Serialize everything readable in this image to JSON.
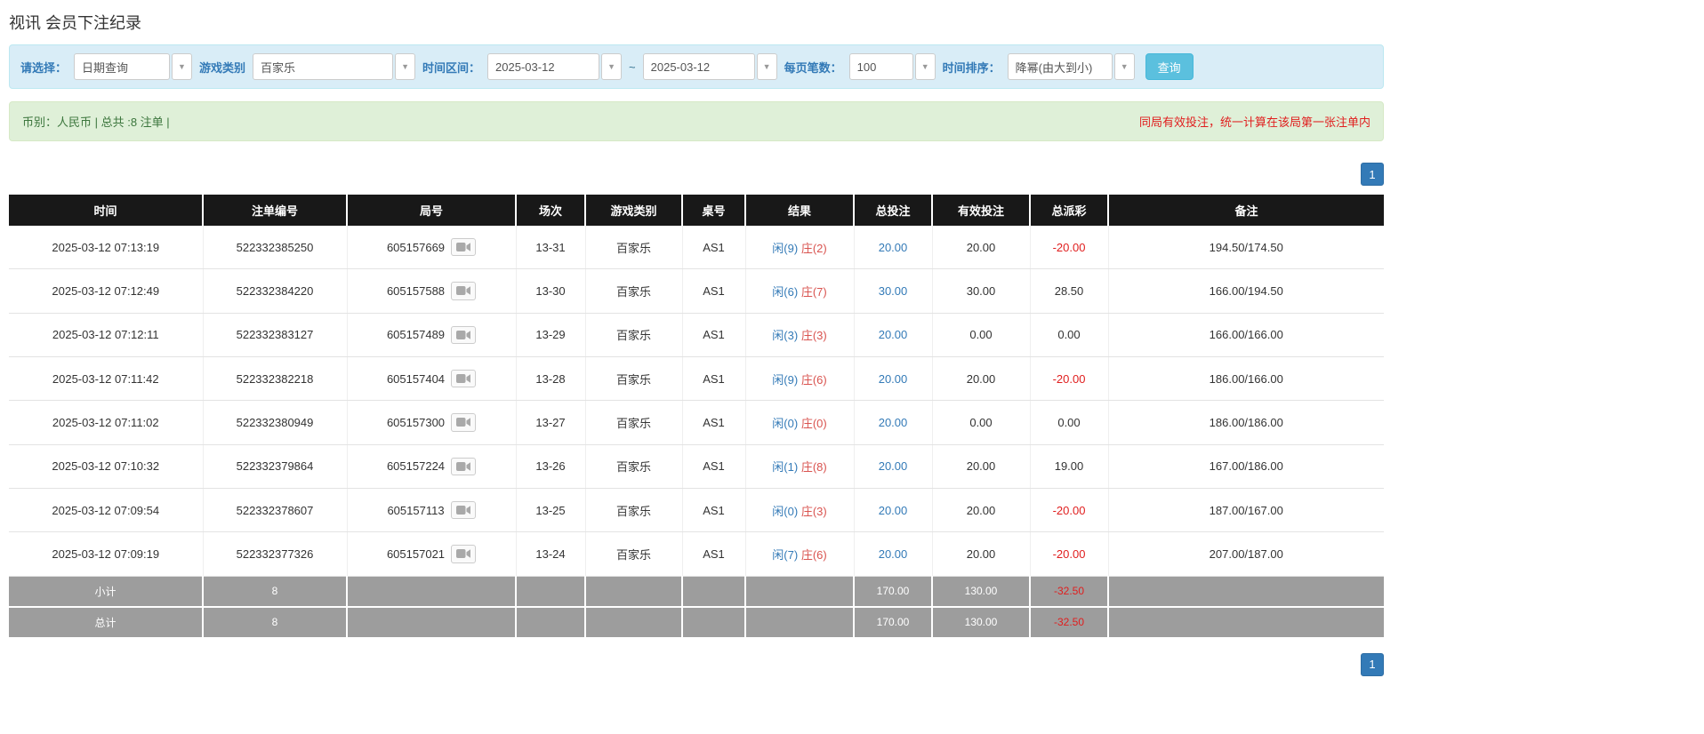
{
  "page": {
    "title": "视讯 会员下注纪录"
  },
  "colors": {
    "accent_blue": "#337ab7",
    "result_banker_red": "#d9534f",
    "negative_red": "#e01e1e",
    "filter_bg": "#d9edf7",
    "summary_bg": "#dff0d8",
    "header_bg": "#181818",
    "footer_bg": "#9d9d9d",
    "search_button_bg": "#5bc0de"
  },
  "icons": {
    "caret": "▼",
    "video": "video-camera-icon"
  },
  "filters": {
    "select_label": "请选择：",
    "select_value": "日期查询",
    "game_type_label": "游戏类别",
    "game_type_value": "百家乐",
    "time_range_label": "时间区间：",
    "date_from": "2025-03-12",
    "range_separator": "~",
    "date_to": "2025-03-12",
    "per_page_label": "每页笔数：",
    "per_page_value": "100",
    "sort_label": "时间排序：",
    "sort_value": "降幂(由大到小)",
    "search_button": "查询"
  },
  "summary": {
    "left": "币别：人民币 | 总共 :8 注单 |",
    "right": "同局有效投注，统一计算在该局第一张注单内"
  },
  "pagination": {
    "page": "1"
  },
  "table": {
    "headers": [
      "时间",
      "注单编号",
      "局号",
      "场次",
      "游戏类别",
      "桌号",
      "结果",
      "总投注",
      "有效投注",
      "总派彩",
      "备注"
    ],
    "rows": [
      {
        "time": "2025-03-12 07:13:19",
        "bet_id": "522332385250",
        "round": "605157669",
        "session": "13-31",
        "game": "百家乐",
        "table_no": "AS1",
        "player": "闲(9)",
        "banker": "庄(2)",
        "total_bet": "20.00",
        "valid_bet": "20.00",
        "payout": "-20.00",
        "remark": "194.50/174.50"
      },
      {
        "time": "2025-03-12 07:12:49",
        "bet_id": "522332384220",
        "round": "605157588",
        "session": "13-30",
        "game": "百家乐",
        "table_no": "AS1",
        "player": "闲(6)",
        "banker": "庄(7)",
        "total_bet": "30.00",
        "valid_bet": "30.00",
        "payout": "28.50",
        "remark": "166.00/194.50"
      },
      {
        "time": "2025-03-12 07:12:11",
        "bet_id": "522332383127",
        "round": "605157489",
        "session": "13-29",
        "game": "百家乐",
        "table_no": "AS1",
        "player": "闲(3)",
        "banker": "庄(3)",
        "total_bet": "20.00",
        "valid_bet": "0.00",
        "payout": "0.00",
        "remark": "166.00/166.00"
      },
      {
        "time": "2025-03-12 07:11:42",
        "bet_id": "522332382218",
        "round": "605157404",
        "session": "13-28",
        "game": "百家乐",
        "table_no": "AS1",
        "player": "闲(9)",
        "banker": "庄(6)",
        "total_bet": "20.00",
        "valid_bet": "20.00",
        "payout": "-20.00",
        "remark": "186.00/166.00"
      },
      {
        "time": "2025-03-12 07:11:02",
        "bet_id": "522332380949",
        "round": "605157300",
        "session": "13-27",
        "game": "百家乐",
        "table_no": "AS1",
        "player": "闲(0)",
        "banker": "庄(0)",
        "total_bet": "20.00",
        "valid_bet": "0.00",
        "payout": "0.00",
        "remark": "186.00/186.00"
      },
      {
        "time": "2025-03-12 07:10:32",
        "bet_id": "522332379864",
        "round": "605157224",
        "session": "13-26",
        "game": "百家乐",
        "table_no": "AS1",
        "player": "闲(1)",
        "banker": "庄(8)",
        "total_bet": "20.00",
        "valid_bet": "20.00",
        "payout": "19.00",
        "remark": "167.00/186.00"
      },
      {
        "time": "2025-03-12 07:09:54",
        "bet_id": "522332378607",
        "round": "605157113",
        "session": "13-25",
        "game": "百家乐",
        "table_no": "AS1",
        "player": "闲(0)",
        "banker": "庄(3)",
        "total_bet": "20.00",
        "valid_bet": "20.00",
        "payout": "-20.00",
        "remark": "187.00/167.00"
      },
      {
        "time": "2025-03-12 07:09:19",
        "bet_id": "522332377326",
        "round": "605157021",
        "session": "13-24",
        "game": "百家乐",
        "table_no": "AS1",
        "player": "闲(7)",
        "banker": "庄(6)",
        "total_bet": "20.00",
        "valid_bet": "20.00",
        "payout": "-20.00",
        "remark": "207.00/187.00"
      }
    ],
    "footer_rows": [
      {
        "label": "小计",
        "count": "8",
        "total_bet": "170.00",
        "valid_bet": "130.00",
        "payout": "-32.50"
      },
      {
        "label": "总计",
        "count": "8",
        "total_bet": "170.00",
        "valid_bet": "130.00",
        "payout": "-32.50"
      }
    ]
  }
}
